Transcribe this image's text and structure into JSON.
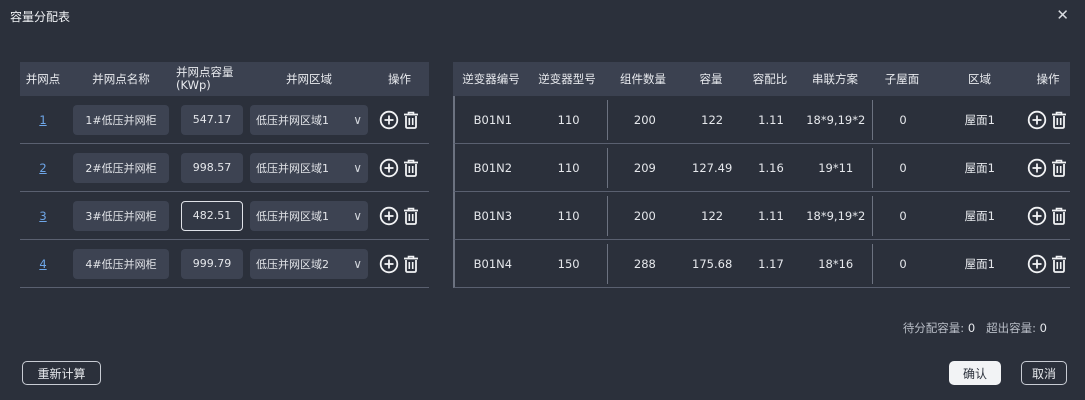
{
  "dialog": {
    "title": "容量分配表",
    "close": "✕"
  },
  "left_table": {
    "headers": [
      "并网点",
      "并网点名称",
      "并网点容量\n(KWp)",
      "并网区域",
      "操作"
    ],
    "rows": [
      {
        "index": "1",
        "name": "1#低压并网柜",
        "capacity": "547.17",
        "region": "低压并网区域1"
      },
      {
        "index": "2",
        "name": "2#低压并网柜",
        "capacity": "998.57",
        "region": "低压并网区域1"
      },
      {
        "index": "3",
        "name": "3#低压并网柜",
        "capacity": "482.51",
        "region": "低压并网区域1"
      },
      {
        "index": "4",
        "name": "4#低压并网柜",
        "capacity": "999.79",
        "region": "低压并网区域2"
      }
    ]
  },
  "right_table": {
    "headers": [
      "逆变器编号",
      "逆变器型号",
      "组件数量",
      "容量",
      "容配比",
      "串联方案",
      "子屋面",
      "区域",
      "操作"
    ],
    "rows": [
      {
        "id": "B01N1",
        "model": "110",
        "count": "200",
        "capacity": "122",
        "ratio": "1.11",
        "scheme": "18*9,19*2",
        "sub_roof": "0",
        "area": "屋面1"
      },
      {
        "id": "B01N2",
        "model": "110",
        "count": "209",
        "capacity": "127.49",
        "ratio": "1.16",
        "scheme": "19*11",
        "sub_roof": "0",
        "area": "屋面1"
      },
      {
        "id": "B01N3",
        "model": "110",
        "count": "200",
        "capacity": "122",
        "ratio": "1.11",
        "scheme": "18*9,19*2",
        "sub_roof": "0",
        "area": "屋面1"
      },
      {
        "id": "B01N4",
        "model": "150",
        "count": "288",
        "capacity": "175.68",
        "ratio": "1.17",
        "scheme": "18*16",
        "sub_roof": "0",
        "area": "屋面1"
      }
    ]
  },
  "summary": {
    "pending_label": "待分配容量:",
    "pending_value": "0",
    "excess_label": "超出容量:",
    "excess_value": "0"
  },
  "buttons": {
    "recalc": "重新计算",
    "confirm": "确认",
    "cancel": "取消"
  },
  "icons": {
    "add": "plus-circle-icon",
    "delete": "trash-icon",
    "dropdown": "chevron-down-icon"
  }
}
